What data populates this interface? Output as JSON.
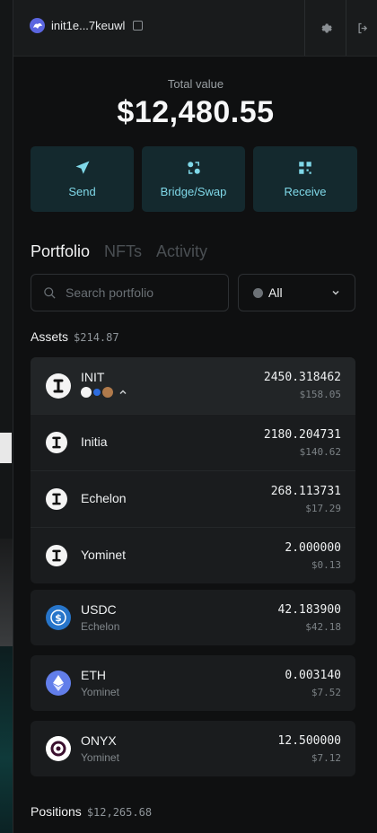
{
  "wallet": {
    "address": "init1e...7keuwl"
  },
  "summary": {
    "label": "Total value",
    "value": "$12,480.55"
  },
  "actions": [
    {
      "label": "Send",
      "icon": "send-icon"
    },
    {
      "label": "Bridge/Swap",
      "icon": "bridge-swap-icon"
    },
    {
      "label": "Receive",
      "icon": "qr-code-icon"
    }
  ],
  "tabs": [
    {
      "label": "Portfolio",
      "active": true
    },
    {
      "label": "NFTs",
      "active": false
    },
    {
      "label": "Activity",
      "active": false
    }
  ],
  "search": {
    "placeholder": "Search portfolio"
  },
  "filter": {
    "label": "All"
  },
  "assets": {
    "title": "Assets",
    "total": "$214.87",
    "init_group": {
      "header": {
        "name": "INIT",
        "amount": "2450.318462",
        "usd": "$158.05"
      },
      "rows": [
        {
          "name": "Initia",
          "amount": "2180.204731",
          "usd": "$140.62"
        },
        {
          "name": "Echelon",
          "amount": "268.113731",
          "usd": "$17.29"
        },
        {
          "name": "Yominet",
          "amount": "2.000000",
          "usd": "$0.13"
        }
      ]
    },
    "tokens": [
      {
        "name": "USDC",
        "chain": "Echelon",
        "amount": "42.183900",
        "usd": "$42.18",
        "color": "#2775ca"
      },
      {
        "name": "ETH",
        "chain": "Yominet",
        "amount": "0.003140",
        "usd": "$7.52",
        "color": "#627eea"
      },
      {
        "name": "ONYX",
        "chain": "Yominet",
        "amount": "12.500000",
        "usd": "$7.12",
        "color": "#ffffff"
      }
    ]
  },
  "positions": {
    "title": "Positions",
    "total": "$12,265.68"
  },
  "colors": {
    "accent": "#7fd8e8",
    "action_bg": "#14292e",
    "panel": "#0f1011"
  }
}
